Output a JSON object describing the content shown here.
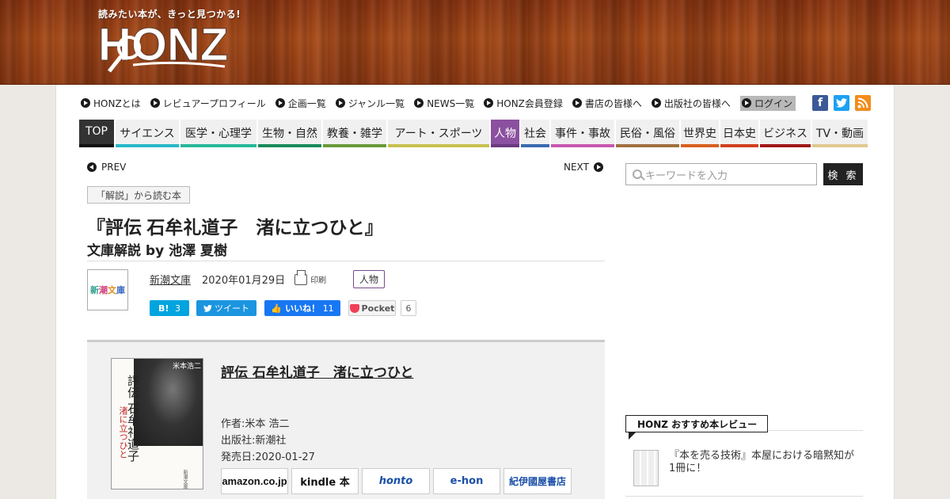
{
  "header": {
    "tagline": "読みたい本が、きっと見つかる!",
    "logo_text": "HONZ"
  },
  "toplinks": [
    {
      "label": "HONZとは"
    },
    {
      "label": "レビュアープロフィール"
    },
    {
      "label": "企画一覧"
    },
    {
      "label": "ジャンル一覧"
    },
    {
      "label": "NEWS一覧"
    },
    {
      "label": "HONZ会員登録"
    },
    {
      "label": "書店の皆様へ"
    },
    {
      "label": "出版社の皆様へ"
    },
    {
      "label": "ログイン"
    }
  ],
  "social_icons": [
    "facebook-icon",
    "twitter-icon",
    "rss-icon"
  ],
  "nav": [
    {
      "label": "TOP",
      "color": "#111111"
    },
    {
      "label": "サイエンス",
      "color": "#28b8c8"
    },
    {
      "label": "医学・心理学",
      "color": "#28b89a"
    },
    {
      "label": "生物・自然",
      "color": "#1a8a5a"
    },
    {
      "label": "教養・雑学",
      "color": "#6a9a3a"
    },
    {
      "label": "アート・スポーツ",
      "color": "#c8c050"
    },
    {
      "label": "人物",
      "color": "#6b3a80"
    },
    {
      "label": "社会",
      "color": "#3a6ab0"
    },
    {
      "label": "事件・事故",
      "color": "#c858b0"
    },
    {
      "label": "民俗・風俗",
      "color": "#a07040"
    },
    {
      "label": "世界史",
      "color": "#d86020"
    },
    {
      "label": "日本史",
      "color": "#d04020"
    },
    {
      "label": "ビジネス",
      "color": "#a01818"
    },
    {
      "label": "TV・動画",
      "color": "#e0c890"
    }
  ],
  "pager": {
    "prev": "PREV",
    "next": "NEXT"
  },
  "article": {
    "category_box": "「解説」から読む本",
    "title": "『評伝 石牟礼道子　渚に立つひと』",
    "subtitle": "文庫解説 by 池澤 夏樹",
    "publisher_logo": [
      "新",
      "潮",
      "文",
      "庫"
    ],
    "publisher": "新潮文庫",
    "date": "2020年01月29日",
    "print_label": "印刷",
    "tag": "人物"
  },
  "share": {
    "hatena_label": "B!",
    "hatena_count": "3",
    "tweet_label": "ツイート",
    "like_label": "いいね！",
    "like_count": "11",
    "pocket_label": "Pocket",
    "pocket_count": "6"
  },
  "book": {
    "cover_author": "米本浩二",
    "cover_title": "評伝 石牟礼道子",
    "cover_sub": "渚に立つひと",
    "cover_publisher": "新潮文庫",
    "title": "評伝 石牟礼道子　渚に立つひと",
    "author": "作者:米本 浩二",
    "publisher": "出版社:新潮社",
    "release": "発売日:2020-01-27",
    "stores": [
      "amazon.co.jp",
      "kindle 本",
      "honto",
      "e-hon",
      "紀伊國屋書店"
    ]
  },
  "sidebar": {
    "search_placeholder": "キーワードを入力",
    "search_button": "検 索",
    "recommend_heading": "HONZ おすすめ本レビュー",
    "recommend_item": "『本を売る技術』本屋における暗黙知が1冊に！"
  }
}
